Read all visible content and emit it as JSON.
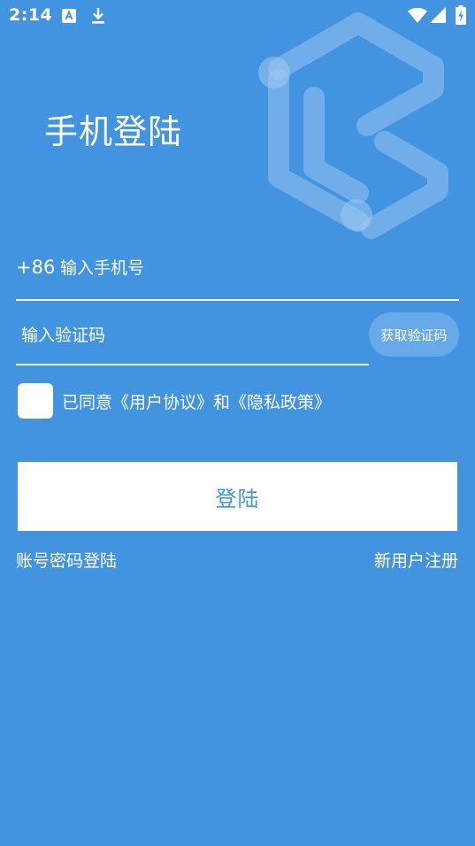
{
  "status_bar": {
    "time": "2:14",
    "icons": [
      "keyboard-a-icon",
      "download-icon",
      "wifi-icon",
      "signal-icon",
      "battery-charging-icon"
    ]
  },
  "logo": {
    "icon": "brand-logo-watermark-icon"
  },
  "page": {
    "title": "手机登陆"
  },
  "form": {
    "country_code": "+86",
    "phone_placeholder": "输入手机号",
    "phone_value": "",
    "code_placeholder": "输入验证码",
    "code_value": "",
    "get_code_label": "获取验证码",
    "agree_checked": false,
    "agree_text": "已同意《用户协议》和《隐私政策》",
    "login_label": "登陆"
  },
  "links": {
    "password_login": "账号密码登陆",
    "register": "新用户注册"
  },
  "colors": {
    "background": "#4293e0",
    "button_bg": "#ffffff",
    "button_text": "#4293e0",
    "code_button_bg": "#68a9e9"
  }
}
